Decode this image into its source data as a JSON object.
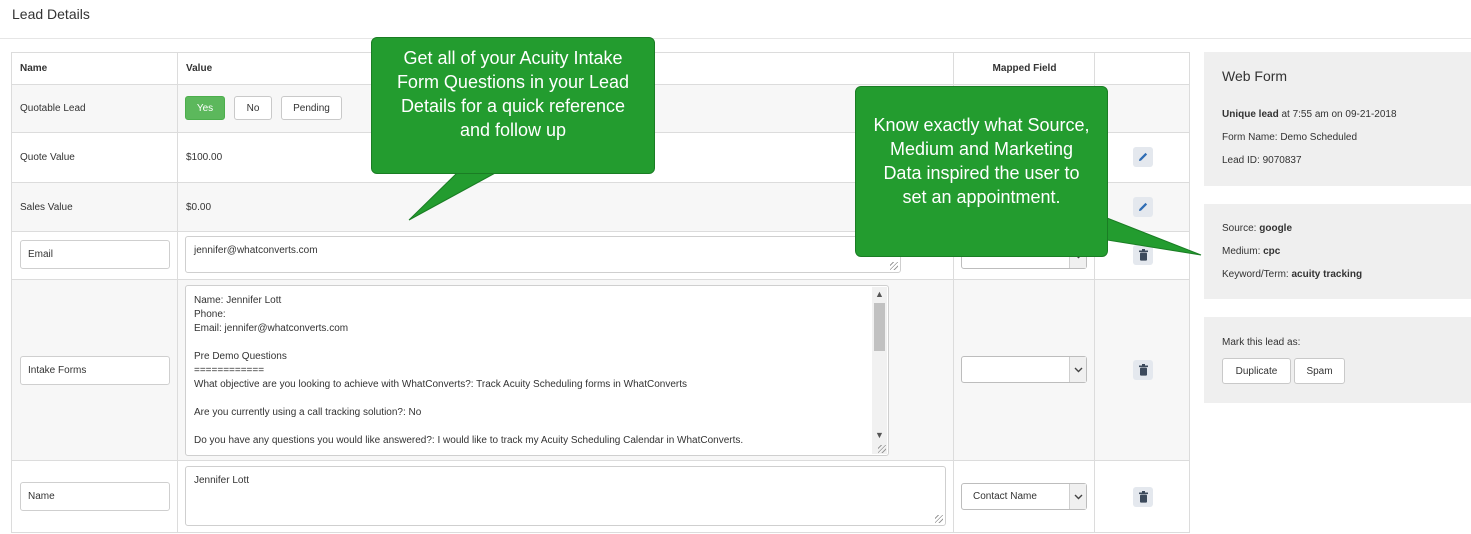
{
  "page": {
    "title": "Lead Details"
  },
  "table": {
    "headers": {
      "name": "Name",
      "value": "Value",
      "mapped": "Mapped Field"
    },
    "quotable": {
      "label": "Quotable Lead",
      "options": [
        "Yes",
        "No",
        "Pending"
      ],
      "selected": "Yes"
    },
    "quote_value": {
      "label": "Quote Value",
      "value": "$100.00"
    },
    "sales_value": {
      "label": "Sales Value",
      "value": "$0.00"
    },
    "email": {
      "name": "Email",
      "value": "jennifer@whatconverts.com"
    },
    "intake": {
      "name": "Intake Forms",
      "lines": [
        "Name: Jennifer Lott",
        "Phone:",
        "Email: jennifer@whatconverts.com",
        "",
        "Pre Demo Questions",
        "============",
        "What objective are you looking to achieve with WhatConverts?: Track Acuity Scheduling forms in WhatConverts",
        "",
        "Are you currently using a call tracking solution?: No",
        "",
        "Do you have any questions you would like answered?: I would like to track my Acuity Scheduling Calendar in WhatConverts."
      ],
      "mapped": ""
    },
    "name_row": {
      "name": "Name",
      "value": "Jennifer Lott",
      "mapped": "Contact Name"
    }
  },
  "callouts": {
    "left": "Get all of your Acuity Intake Form Questions in your Lead Details for a quick reference and follow up",
    "right": "Know exactly what Source, Medium and Marketing Data inspired the user to set an appointment."
  },
  "web_form": {
    "title": "Web Form",
    "unique_prefix": "Unique lead",
    "unique_rest": " at 7:55 am on 09-21-2018",
    "form_name": "Form Name: Demo Scheduled",
    "lead_id": "Lead ID: 9070837"
  },
  "marketing": {
    "source_label": "Source: ",
    "source": "google",
    "medium_label": "Medium: ",
    "medium": "cpc",
    "keyword_label": "Keyword/Term: ",
    "keyword": "acuity tracking"
  },
  "mark": {
    "label": "Mark this lead as:",
    "duplicate": "Duplicate",
    "spam": "Spam"
  },
  "colors": {
    "accent_green": "#239c2f",
    "button_green": "#5cb85c",
    "panel_bg": "#efefef"
  },
  "icons": {
    "edit": "pencil-icon",
    "delete": "trash-icon",
    "dropdown": "chevron-down-icon"
  }
}
